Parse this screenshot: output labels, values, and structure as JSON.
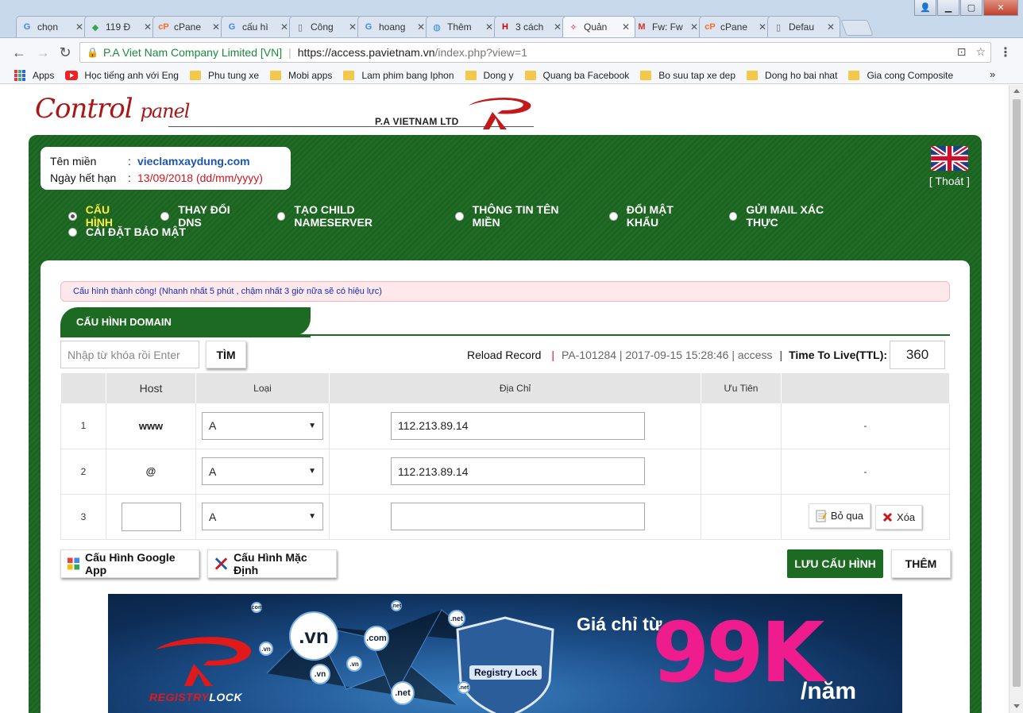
{
  "browser": {
    "tabs": [
      {
        "label": "chọn",
        "icon": "google-icon",
        "active": false
      },
      {
        "label": "119 Đ",
        "icon": "maps-icon",
        "active": false
      },
      {
        "label": "cPane",
        "icon": "cpanel-icon",
        "active": false
      },
      {
        "label": "cấu hì",
        "icon": "google-icon",
        "active": false
      },
      {
        "label": "Công",
        "icon": "document-icon",
        "active": false
      },
      {
        "label": "hoang",
        "icon": "google-icon",
        "active": false
      },
      {
        "label": "Thêm",
        "icon": "globe-icon",
        "active": false
      },
      {
        "label": "3 cách",
        "icon": "h-vn-icon",
        "active": false
      },
      {
        "label": "Quản",
        "icon": "pa-icon",
        "active": true
      },
      {
        "label": "Fw: Fw",
        "icon": "gmail-icon",
        "active": false
      },
      {
        "label": "cPane",
        "icon": "cpanel-icon",
        "active": false
      },
      {
        "label": "Defau",
        "icon": "document-icon",
        "active": false
      }
    ],
    "address": {
      "org": "P.A Viet Nam Company Limited [VN]",
      "host": "https://access.pavietnam.vn",
      "path": "/index.php?view=1"
    },
    "bookmarks": [
      {
        "label": "Apps",
        "icon": "apps-icon"
      },
      {
        "label": "Học tiếng anh với Eng",
        "icon": "youtube-icon"
      },
      {
        "label": "Phu tung xe",
        "icon": "folder-icon"
      },
      {
        "label": "Mobi apps",
        "icon": "folder-icon"
      },
      {
        "label": "Lam phim bang Iphon",
        "icon": "folder-icon"
      },
      {
        "label": "Dong y",
        "icon": "folder-icon"
      },
      {
        "label": "Quang ba Facebook",
        "icon": "folder-icon"
      },
      {
        "label": "Bo suu tap xe dep",
        "icon": "folder-icon"
      },
      {
        "label": "Dong ho bai nhat",
        "icon": "folder-icon"
      },
      {
        "label": "Gia cong Composite",
        "icon": "folder-icon"
      }
    ],
    "bookmarks_more": "»"
  },
  "header": {
    "logo_main": "Control",
    "logo_small": "panel",
    "company": "P.A VIETNAM LTD"
  },
  "domain_info": {
    "domain_label": "Tên miền",
    "domain_value": "vieclamxaydung.com",
    "expiry_label": "Ngày hết hạn",
    "expiry_value": "13/09/2018 (dd/mm/yyyy)",
    "colon": ":"
  },
  "logout_label": "[ Thoát ]",
  "menu": {
    "items": [
      {
        "label": "CẤU HÌNH",
        "selected": true
      },
      {
        "label": "THAY ĐỔI DNS",
        "selected": false
      },
      {
        "label": "TẠO CHILD NAMESERVER",
        "selected": false
      },
      {
        "label": "THÔNG TIN TÊN MIỀN",
        "selected": false
      },
      {
        "label": "ĐỔI MẬT KHẨU",
        "selected": false
      },
      {
        "label": "GỬI MAIL XÁC THỰC",
        "selected": false
      },
      {
        "label": "CÀI ĐẶT BẢO MẬT",
        "selected": false
      }
    ]
  },
  "alert": "Cấu hình thành công! (Nhanh nhất 5 phút , chậm nhất 3 giờ nữa sẽ có hiệu lực)",
  "section_title": "CẤU HÌNH DOMAIN",
  "search": {
    "placeholder": "Nhập từ khóa rồi Enter",
    "button": "TÌM"
  },
  "record_info": {
    "reload": "Reload Record",
    "separator": "|",
    "meta": "PA-101284 | 2017-09-15 15:28:46 | access",
    "ttl_label": "Time To Live(TTL):",
    "ttl_value": "360"
  },
  "table": {
    "headers": [
      "",
      "Host",
      "Loại",
      "Địa Chỉ",
      "Ưu Tiên",
      ""
    ],
    "rows": [
      {
        "num": "1",
        "host": "www",
        "type": "A",
        "address": "112.213.89.14",
        "priority": "",
        "action": "-"
      },
      {
        "num": "2",
        "host": "@",
        "type": "A",
        "address": "112.213.89.14",
        "priority": "",
        "action": "-"
      },
      {
        "num": "3",
        "host": "",
        "type": "A",
        "address": "",
        "priority": "",
        "skip_label": "Bỏ qua",
        "delete_label": "Xóa"
      }
    ]
  },
  "buttons": {
    "google_app": "Cấu Hình Google App",
    "default_config": "Cấu Hình Mặc Định",
    "save": "LƯU CẤU HÌNH",
    "add": "THÊM"
  },
  "banner": {
    "brand_a": "REGISTRY",
    "brand_b": "LOCK",
    "shield_label": "Registry Lock",
    "price_label": "Giá chỉ từ",
    "price": "99K",
    "unit": "/năm",
    "bubbles": [
      ".vn",
      ".com",
      ".net",
      ".vn",
      ".net",
      ".vn",
      ".net",
      ".com",
      ".vn",
      ".net"
    ]
  },
  "colors": {
    "green": "#1d6b22",
    "alert_bg": "#fde8ec",
    "link_blue": "#1e55b0",
    "red": "#d0141e",
    "price_pink": "#ee1c8c"
  }
}
